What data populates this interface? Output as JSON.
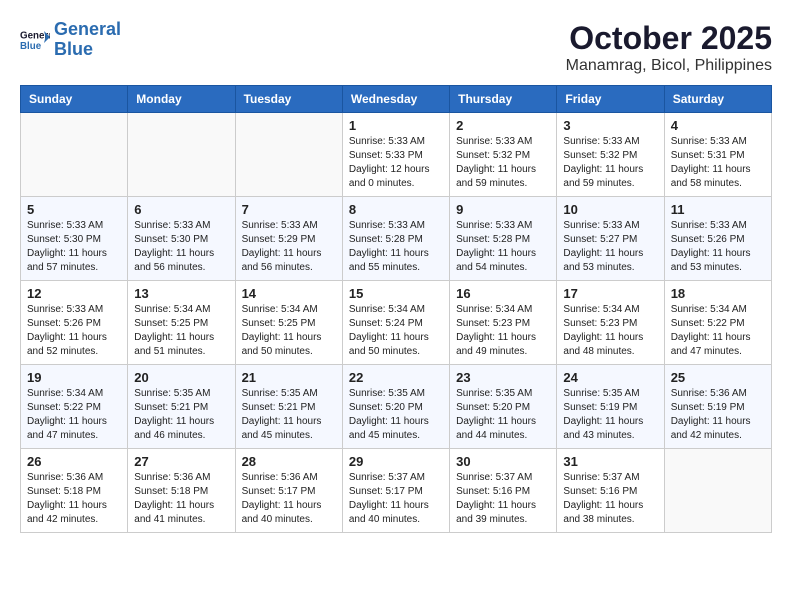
{
  "header": {
    "logo": {
      "line1": "General",
      "line2": "Blue"
    },
    "title": "October 2025",
    "location": "Manamrag, Bicol, Philippines"
  },
  "weekdays": [
    "Sunday",
    "Monday",
    "Tuesday",
    "Wednesday",
    "Thursday",
    "Friday",
    "Saturday"
  ],
  "weeks": [
    [
      {
        "day": null,
        "sunrise": null,
        "sunset": null,
        "daylight": null
      },
      {
        "day": null,
        "sunrise": null,
        "sunset": null,
        "daylight": null
      },
      {
        "day": null,
        "sunrise": null,
        "sunset": null,
        "daylight": null
      },
      {
        "day": "1",
        "sunrise": "Sunrise: 5:33 AM",
        "sunset": "Sunset: 5:33 PM",
        "daylight": "Daylight: 12 hours and 0 minutes."
      },
      {
        "day": "2",
        "sunrise": "Sunrise: 5:33 AM",
        "sunset": "Sunset: 5:32 PM",
        "daylight": "Daylight: 11 hours and 59 minutes."
      },
      {
        "day": "3",
        "sunrise": "Sunrise: 5:33 AM",
        "sunset": "Sunset: 5:32 PM",
        "daylight": "Daylight: 11 hours and 59 minutes."
      },
      {
        "day": "4",
        "sunrise": "Sunrise: 5:33 AM",
        "sunset": "Sunset: 5:31 PM",
        "daylight": "Daylight: 11 hours and 58 minutes."
      }
    ],
    [
      {
        "day": "5",
        "sunrise": "Sunrise: 5:33 AM",
        "sunset": "Sunset: 5:30 PM",
        "daylight": "Daylight: 11 hours and 57 minutes."
      },
      {
        "day": "6",
        "sunrise": "Sunrise: 5:33 AM",
        "sunset": "Sunset: 5:30 PM",
        "daylight": "Daylight: 11 hours and 56 minutes."
      },
      {
        "day": "7",
        "sunrise": "Sunrise: 5:33 AM",
        "sunset": "Sunset: 5:29 PM",
        "daylight": "Daylight: 11 hours and 56 minutes."
      },
      {
        "day": "8",
        "sunrise": "Sunrise: 5:33 AM",
        "sunset": "Sunset: 5:28 PM",
        "daylight": "Daylight: 11 hours and 55 minutes."
      },
      {
        "day": "9",
        "sunrise": "Sunrise: 5:33 AM",
        "sunset": "Sunset: 5:28 PM",
        "daylight": "Daylight: 11 hours and 54 minutes."
      },
      {
        "day": "10",
        "sunrise": "Sunrise: 5:33 AM",
        "sunset": "Sunset: 5:27 PM",
        "daylight": "Daylight: 11 hours and 53 minutes."
      },
      {
        "day": "11",
        "sunrise": "Sunrise: 5:33 AM",
        "sunset": "Sunset: 5:26 PM",
        "daylight": "Daylight: 11 hours and 53 minutes."
      }
    ],
    [
      {
        "day": "12",
        "sunrise": "Sunrise: 5:33 AM",
        "sunset": "Sunset: 5:26 PM",
        "daylight": "Daylight: 11 hours and 52 minutes."
      },
      {
        "day": "13",
        "sunrise": "Sunrise: 5:34 AM",
        "sunset": "Sunset: 5:25 PM",
        "daylight": "Daylight: 11 hours and 51 minutes."
      },
      {
        "day": "14",
        "sunrise": "Sunrise: 5:34 AM",
        "sunset": "Sunset: 5:25 PM",
        "daylight": "Daylight: 11 hours and 50 minutes."
      },
      {
        "day": "15",
        "sunrise": "Sunrise: 5:34 AM",
        "sunset": "Sunset: 5:24 PM",
        "daylight": "Daylight: 11 hours and 50 minutes."
      },
      {
        "day": "16",
        "sunrise": "Sunrise: 5:34 AM",
        "sunset": "Sunset: 5:23 PM",
        "daylight": "Daylight: 11 hours and 49 minutes."
      },
      {
        "day": "17",
        "sunrise": "Sunrise: 5:34 AM",
        "sunset": "Sunset: 5:23 PM",
        "daylight": "Daylight: 11 hours and 48 minutes."
      },
      {
        "day": "18",
        "sunrise": "Sunrise: 5:34 AM",
        "sunset": "Sunset: 5:22 PM",
        "daylight": "Daylight: 11 hours and 47 minutes."
      }
    ],
    [
      {
        "day": "19",
        "sunrise": "Sunrise: 5:34 AM",
        "sunset": "Sunset: 5:22 PM",
        "daylight": "Daylight: 11 hours and 47 minutes."
      },
      {
        "day": "20",
        "sunrise": "Sunrise: 5:35 AM",
        "sunset": "Sunset: 5:21 PM",
        "daylight": "Daylight: 11 hours and 46 minutes."
      },
      {
        "day": "21",
        "sunrise": "Sunrise: 5:35 AM",
        "sunset": "Sunset: 5:21 PM",
        "daylight": "Daylight: 11 hours and 45 minutes."
      },
      {
        "day": "22",
        "sunrise": "Sunrise: 5:35 AM",
        "sunset": "Sunset: 5:20 PM",
        "daylight": "Daylight: 11 hours and 45 minutes."
      },
      {
        "day": "23",
        "sunrise": "Sunrise: 5:35 AM",
        "sunset": "Sunset: 5:20 PM",
        "daylight": "Daylight: 11 hours and 44 minutes."
      },
      {
        "day": "24",
        "sunrise": "Sunrise: 5:35 AM",
        "sunset": "Sunset: 5:19 PM",
        "daylight": "Daylight: 11 hours and 43 minutes."
      },
      {
        "day": "25",
        "sunrise": "Sunrise: 5:36 AM",
        "sunset": "Sunset: 5:19 PM",
        "daylight": "Daylight: 11 hours and 42 minutes."
      }
    ],
    [
      {
        "day": "26",
        "sunrise": "Sunrise: 5:36 AM",
        "sunset": "Sunset: 5:18 PM",
        "daylight": "Daylight: 11 hours and 42 minutes."
      },
      {
        "day": "27",
        "sunrise": "Sunrise: 5:36 AM",
        "sunset": "Sunset: 5:18 PM",
        "daylight": "Daylight: 11 hours and 41 minutes."
      },
      {
        "day": "28",
        "sunrise": "Sunrise: 5:36 AM",
        "sunset": "Sunset: 5:17 PM",
        "daylight": "Daylight: 11 hours and 40 minutes."
      },
      {
        "day": "29",
        "sunrise": "Sunrise: 5:37 AM",
        "sunset": "Sunset: 5:17 PM",
        "daylight": "Daylight: 11 hours and 40 minutes."
      },
      {
        "day": "30",
        "sunrise": "Sunrise: 5:37 AM",
        "sunset": "Sunset: 5:16 PM",
        "daylight": "Daylight: 11 hours and 39 minutes."
      },
      {
        "day": "31",
        "sunrise": "Sunrise: 5:37 AM",
        "sunset": "Sunset: 5:16 PM",
        "daylight": "Daylight: 11 hours and 38 minutes."
      },
      {
        "day": null,
        "sunrise": null,
        "sunset": null,
        "daylight": null
      }
    ]
  ]
}
